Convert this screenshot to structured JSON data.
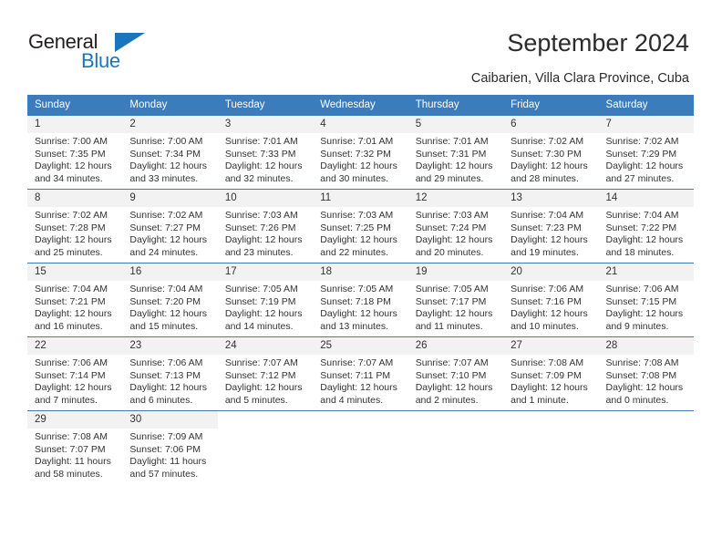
{
  "brand": {
    "name_part1": "General",
    "name_part2": "Blue",
    "flag_icon": "triangle-flag-icon",
    "accent_color": "#1a76bc"
  },
  "header": {
    "title": "September 2024",
    "location": "Caibarien, Villa Clara Province, Cuba"
  },
  "theme": {
    "header_row_bg": "#3a7cbc",
    "daynum_bg": "#f2f2f2",
    "grid_line": "#3a7cbc",
    "text": "#333333"
  },
  "weekdays": [
    "Sunday",
    "Monday",
    "Tuesday",
    "Wednesday",
    "Thursday",
    "Friday",
    "Saturday"
  ],
  "labels": {
    "sunrise": "Sunrise:",
    "sunset": "Sunset:",
    "daylight": "Daylight:"
  },
  "weeks": [
    [
      {
        "day": "1",
        "sunrise": "Sunrise: 7:00 AM",
        "sunset": "Sunset: 7:35 PM",
        "daylight1": "Daylight: 12 hours",
        "daylight2": "and 34 minutes."
      },
      {
        "day": "2",
        "sunrise": "Sunrise: 7:00 AM",
        "sunset": "Sunset: 7:34 PM",
        "daylight1": "Daylight: 12 hours",
        "daylight2": "and 33 minutes."
      },
      {
        "day": "3",
        "sunrise": "Sunrise: 7:01 AM",
        "sunset": "Sunset: 7:33 PM",
        "daylight1": "Daylight: 12 hours",
        "daylight2": "and 32 minutes."
      },
      {
        "day": "4",
        "sunrise": "Sunrise: 7:01 AM",
        "sunset": "Sunset: 7:32 PM",
        "daylight1": "Daylight: 12 hours",
        "daylight2": "and 30 minutes."
      },
      {
        "day": "5",
        "sunrise": "Sunrise: 7:01 AM",
        "sunset": "Sunset: 7:31 PM",
        "daylight1": "Daylight: 12 hours",
        "daylight2": "and 29 minutes."
      },
      {
        "day": "6",
        "sunrise": "Sunrise: 7:02 AM",
        "sunset": "Sunset: 7:30 PM",
        "daylight1": "Daylight: 12 hours",
        "daylight2": "and 28 minutes."
      },
      {
        "day": "7",
        "sunrise": "Sunrise: 7:02 AM",
        "sunset": "Sunset: 7:29 PM",
        "daylight1": "Daylight: 12 hours",
        "daylight2": "and 27 minutes."
      }
    ],
    [
      {
        "day": "8",
        "sunrise": "Sunrise: 7:02 AM",
        "sunset": "Sunset: 7:28 PM",
        "daylight1": "Daylight: 12 hours",
        "daylight2": "and 25 minutes."
      },
      {
        "day": "9",
        "sunrise": "Sunrise: 7:02 AM",
        "sunset": "Sunset: 7:27 PM",
        "daylight1": "Daylight: 12 hours",
        "daylight2": "and 24 minutes."
      },
      {
        "day": "10",
        "sunrise": "Sunrise: 7:03 AM",
        "sunset": "Sunset: 7:26 PM",
        "daylight1": "Daylight: 12 hours",
        "daylight2": "and 23 minutes."
      },
      {
        "day": "11",
        "sunrise": "Sunrise: 7:03 AM",
        "sunset": "Sunset: 7:25 PM",
        "daylight1": "Daylight: 12 hours",
        "daylight2": "and 22 minutes."
      },
      {
        "day": "12",
        "sunrise": "Sunrise: 7:03 AM",
        "sunset": "Sunset: 7:24 PM",
        "daylight1": "Daylight: 12 hours",
        "daylight2": "and 20 minutes."
      },
      {
        "day": "13",
        "sunrise": "Sunrise: 7:04 AM",
        "sunset": "Sunset: 7:23 PM",
        "daylight1": "Daylight: 12 hours",
        "daylight2": "and 19 minutes."
      },
      {
        "day": "14",
        "sunrise": "Sunrise: 7:04 AM",
        "sunset": "Sunset: 7:22 PM",
        "daylight1": "Daylight: 12 hours",
        "daylight2": "and 18 minutes."
      }
    ],
    [
      {
        "day": "15",
        "sunrise": "Sunrise: 7:04 AM",
        "sunset": "Sunset: 7:21 PM",
        "daylight1": "Daylight: 12 hours",
        "daylight2": "and 16 minutes."
      },
      {
        "day": "16",
        "sunrise": "Sunrise: 7:04 AM",
        "sunset": "Sunset: 7:20 PM",
        "daylight1": "Daylight: 12 hours",
        "daylight2": "and 15 minutes."
      },
      {
        "day": "17",
        "sunrise": "Sunrise: 7:05 AM",
        "sunset": "Sunset: 7:19 PM",
        "daylight1": "Daylight: 12 hours",
        "daylight2": "and 14 minutes."
      },
      {
        "day": "18",
        "sunrise": "Sunrise: 7:05 AM",
        "sunset": "Sunset: 7:18 PM",
        "daylight1": "Daylight: 12 hours",
        "daylight2": "and 13 minutes."
      },
      {
        "day": "19",
        "sunrise": "Sunrise: 7:05 AM",
        "sunset": "Sunset: 7:17 PM",
        "daylight1": "Daylight: 12 hours",
        "daylight2": "and 11 minutes."
      },
      {
        "day": "20",
        "sunrise": "Sunrise: 7:06 AM",
        "sunset": "Sunset: 7:16 PM",
        "daylight1": "Daylight: 12 hours",
        "daylight2": "and 10 minutes."
      },
      {
        "day": "21",
        "sunrise": "Sunrise: 7:06 AM",
        "sunset": "Sunset: 7:15 PM",
        "daylight1": "Daylight: 12 hours",
        "daylight2": "and 9 minutes."
      }
    ],
    [
      {
        "day": "22",
        "sunrise": "Sunrise: 7:06 AM",
        "sunset": "Sunset: 7:14 PM",
        "daylight1": "Daylight: 12 hours",
        "daylight2": "and 7 minutes."
      },
      {
        "day": "23",
        "sunrise": "Sunrise: 7:06 AM",
        "sunset": "Sunset: 7:13 PM",
        "daylight1": "Daylight: 12 hours",
        "daylight2": "and 6 minutes."
      },
      {
        "day": "24",
        "sunrise": "Sunrise: 7:07 AM",
        "sunset": "Sunset: 7:12 PM",
        "daylight1": "Daylight: 12 hours",
        "daylight2": "and 5 minutes."
      },
      {
        "day": "25",
        "sunrise": "Sunrise: 7:07 AM",
        "sunset": "Sunset: 7:11 PM",
        "daylight1": "Daylight: 12 hours",
        "daylight2": "and 4 minutes."
      },
      {
        "day": "26",
        "sunrise": "Sunrise: 7:07 AM",
        "sunset": "Sunset: 7:10 PM",
        "daylight1": "Daylight: 12 hours",
        "daylight2": "and 2 minutes."
      },
      {
        "day": "27",
        "sunrise": "Sunrise: 7:08 AM",
        "sunset": "Sunset: 7:09 PM",
        "daylight1": "Daylight: 12 hours",
        "daylight2": "and 1 minute."
      },
      {
        "day": "28",
        "sunrise": "Sunrise: 7:08 AM",
        "sunset": "Sunset: 7:08 PM",
        "daylight1": "Daylight: 12 hours",
        "daylight2": "and 0 minutes."
      }
    ],
    [
      {
        "day": "29",
        "sunrise": "Sunrise: 7:08 AM",
        "sunset": "Sunset: 7:07 PM",
        "daylight1": "Daylight: 11 hours",
        "daylight2": "and 58 minutes."
      },
      {
        "day": "30",
        "sunrise": "Sunrise: 7:09 AM",
        "sunset": "Sunset: 7:06 PM",
        "daylight1": "Daylight: 11 hours",
        "daylight2": "and 57 minutes."
      },
      {
        "day": "",
        "sunrise": "",
        "sunset": "",
        "daylight1": "",
        "daylight2": ""
      },
      {
        "day": "",
        "sunrise": "",
        "sunset": "",
        "daylight1": "",
        "daylight2": ""
      },
      {
        "day": "",
        "sunrise": "",
        "sunset": "",
        "daylight1": "",
        "daylight2": ""
      },
      {
        "day": "",
        "sunrise": "",
        "sunset": "",
        "daylight1": "",
        "daylight2": ""
      },
      {
        "day": "",
        "sunrise": "",
        "sunset": "",
        "daylight1": "",
        "daylight2": ""
      }
    ]
  ]
}
